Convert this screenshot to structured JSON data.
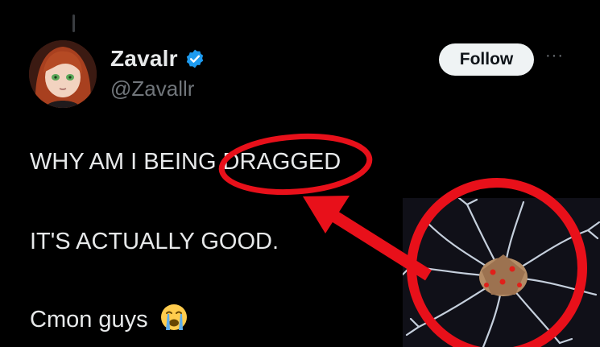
{
  "tweet": {
    "author": {
      "display_name": "Zavalr",
      "handle": "@Zavallr",
      "verified": true,
      "verified_color": "#1d9bf0"
    },
    "follow_label": "Follow",
    "more_label": "···",
    "lines": [
      "WHY AM I BEING DRAGGED",
      "IT'S ACTUALLY GOOD.",
      "Cmon guys"
    ],
    "emoji": "loudly-crying-face-icon"
  },
  "annotation": {
    "color": "#e8101a",
    "icons": [
      "red-circle-highlight",
      "red-arrow",
      "red-circle-on-image"
    ]
  }
}
